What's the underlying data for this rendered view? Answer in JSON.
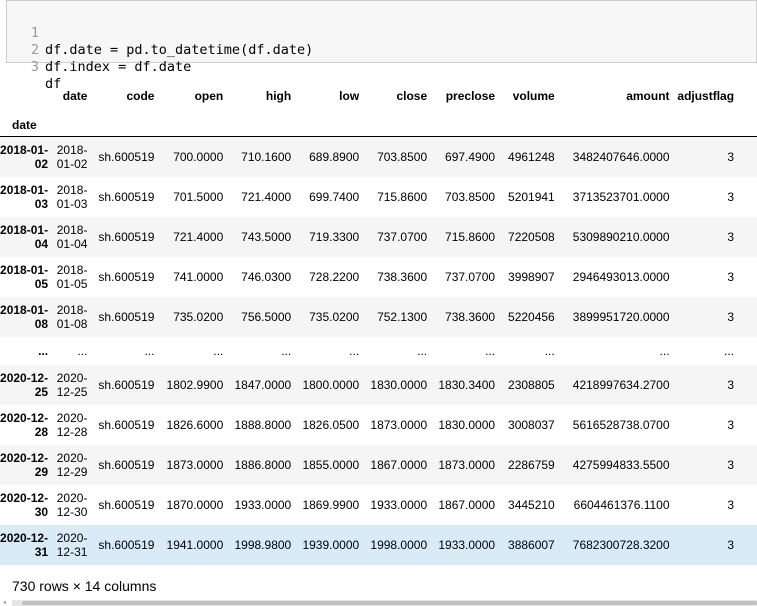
{
  "code_lines": [
    {
      "n": "1",
      "text": "df.date = pd.to_datetime(df.date)"
    },
    {
      "n": "2",
      "text": "df.index = df.date"
    },
    {
      "n": "3",
      "text": "df"
    }
  ],
  "table": {
    "columns": [
      "date",
      "code",
      "open",
      "high",
      "low",
      "close",
      "preclose",
      "volume",
      "amount",
      "adjustflag"
    ],
    "index_name": "date",
    "rows": [
      {
        "idx": "2018-01-02",
        "cells": [
          "2018-01-02",
          "sh.600519",
          "700.0000",
          "710.1600",
          "689.8900",
          "703.8500",
          "697.4900",
          "4961248",
          "3482407646.0000",
          "3"
        ]
      },
      {
        "idx": "2018-01-03",
        "cells": [
          "2018-01-03",
          "sh.600519",
          "701.5000",
          "721.4000",
          "699.7400",
          "715.8600",
          "703.8500",
          "5201941",
          "3713523701.0000",
          "3"
        ]
      },
      {
        "idx": "2018-01-04",
        "cells": [
          "2018-01-04",
          "sh.600519",
          "721.4000",
          "743.5000",
          "719.3300",
          "737.0700",
          "715.8600",
          "7220508",
          "5309890210.0000",
          "3"
        ]
      },
      {
        "idx": "2018-01-05",
        "cells": [
          "2018-01-05",
          "sh.600519",
          "741.0000",
          "746.0300",
          "728.2200",
          "738.3600",
          "737.0700",
          "3998907",
          "2946493013.0000",
          "3"
        ]
      },
      {
        "idx": "2018-01-08",
        "cells": [
          "2018-01-08",
          "sh.600519",
          "735.0200",
          "756.5000",
          "735.0200",
          "752.1300",
          "738.3600",
          "5220456",
          "3899951720.0000",
          "3"
        ]
      },
      {
        "idx": "...",
        "cells": [
          "...",
          "...",
          "...",
          "...",
          "...",
          "...",
          "...",
          "...",
          "...",
          "..."
        ],
        "ellipsis": true
      },
      {
        "idx": "2020-12-25",
        "cells": [
          "2020-12-25",
          "sh.600519",
          "1802.9900",
          "1847.0000",
          "1800.0000",
          "1830.0000",
          "1830.3400",
          "2308805",
          "4218997634.2700",
          "3"
        ]
      },
      {
        "idx": "2020-12-28",
        "cells": [
          "2020-12-28",
          "sh.600519",
          "1826.6000",
          "1888.8000",
          "1826.0500",
          "1873.0000",
          "1830.0000",
          "3008037",
          "5616528738.0700",
          "3"
        ]
      },
      {
        "idx": "2020-12-29",
        "cells": [
          "2020-12-29",
          "sh.600519",
          "1873.0000",
          "1886.8000",
          "1855.0000",
          "1867.0000",
          "1873.0000",
          "2286759",
          "4275994833.5500",
          "3"
        ]
      },
      {
        "idx": "2020-12-30",
        "cells": [
          "2020-12-30",
          "sh.600519",
          "1870.0000",
          "1933.0000",
          "1869.9900",
          "1933.0000",
          "1867.0000",
          "3445210",
          "6604461376.1100",
          "3"
        ]
      },
      {
        "idx": "2020-12-31",
        "cells": [
          "2020-12-31",
          "sh.600519",
          "1941.0000",
          "1998.9800",
          "1939.0000",
          "1998.0000",
          "1933.0000",
          "3886007",
          "7682300728.3200",
          "3"
        ],
        "highlight": true
      }
    ]
  },
  "footer": "730 rows × 14 columns"
}
